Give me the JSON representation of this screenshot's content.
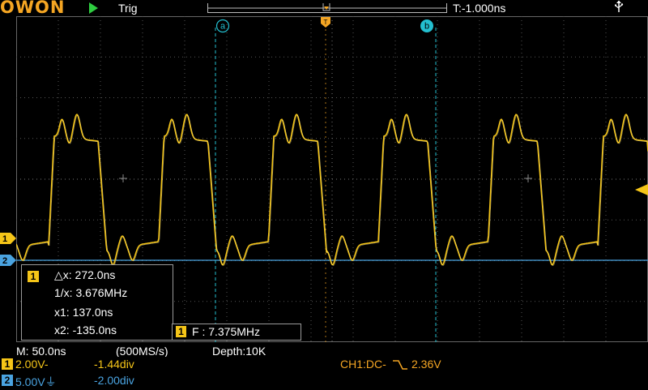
{
  "header": {
    "logo": "OWON",
    "run_state_icon": "play-icon",
    "trigger_label": "Trig",
    "trigger_time": "T:-1.000ns",
    "usb_icon": "usb-icon"
  },
  "cursors": {
    "a_label": "a",
    "b_label": "b",
    "trigger_marker_label": "T"
  },
  "channel_markers": {
    "ch1": "1",
    "ch2": "2"
  },
  "measurement": {
    "channel": "1",
    "delta_x": "△x: 272.0ns",
    "inv_x": "1/x: 3.676MHz",
    "x1": "x1: 137.0ns",
    "x2": "x2: -135.0ns"
  },
  "frequency": {
    "channel": "1",
    "text": "F : 7.375MHz"
  },
  "status": {
    "timebase": "M: 50.0ns",
    "sample_rate": "(500MS/s)",
    "depth": "Depth:10K"
  },
  "channels": [
    {
      "id": "1",
      "scale": "2.00V-",
      "offset": "-1.44div",
      "color": "#f5c518"
    },
    {
      "id": "2",
      "scale": "5.00V⏚",
      "offset": "-2.00div",
      "color": "#4aa3e0"
    }
  ],
  "trigger_info": {
    "source": "CH1:DC-",
    "edge_icon": "falling-edge-icon",
    "level": "2.36V"
  },
  "colors": {
    "ch1": "#f5c518",
    "ch2": "#4aa3e0",
    "cursor": "#23bfd0",
    "accent": "#f5a623",
    "grid": "#555555"
  }
}
